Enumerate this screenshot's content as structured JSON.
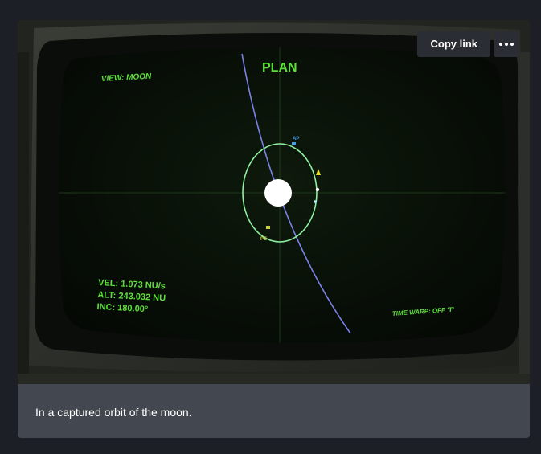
{
  "actions": {
    "copy_link_label": "Copy link",
    "more_icon": "ellipsis-icon"
  },
  "hud": {
    "view_label": "VIEW: MOON",
    "title": "PLAN",
    "apoapsis_label": "AP",
    "periapsis_label": "PE",
    "velocity": "VEL: 1.073 NU/s",
    "altitude": "ALT: 243.032 NU",
    "inclination": "INC: 180.00°",
    "time_warp": "TIME WARP: OFF 'T'"
  },
  "caption": "In a captured orbit of the moon.",
  "colors": {
    "hud_green": "#5ee03c",
    "orbit_green": "#8ef0a0",
    "trajectory_blue": "#7a82e8",
    "apoapsis_blue": "#4a9de0",
    "periapsis_yellow": "#c8d040",
    "caption_bg": "#43474f",
    "page_bg": "#1c1f26"
  }
}
